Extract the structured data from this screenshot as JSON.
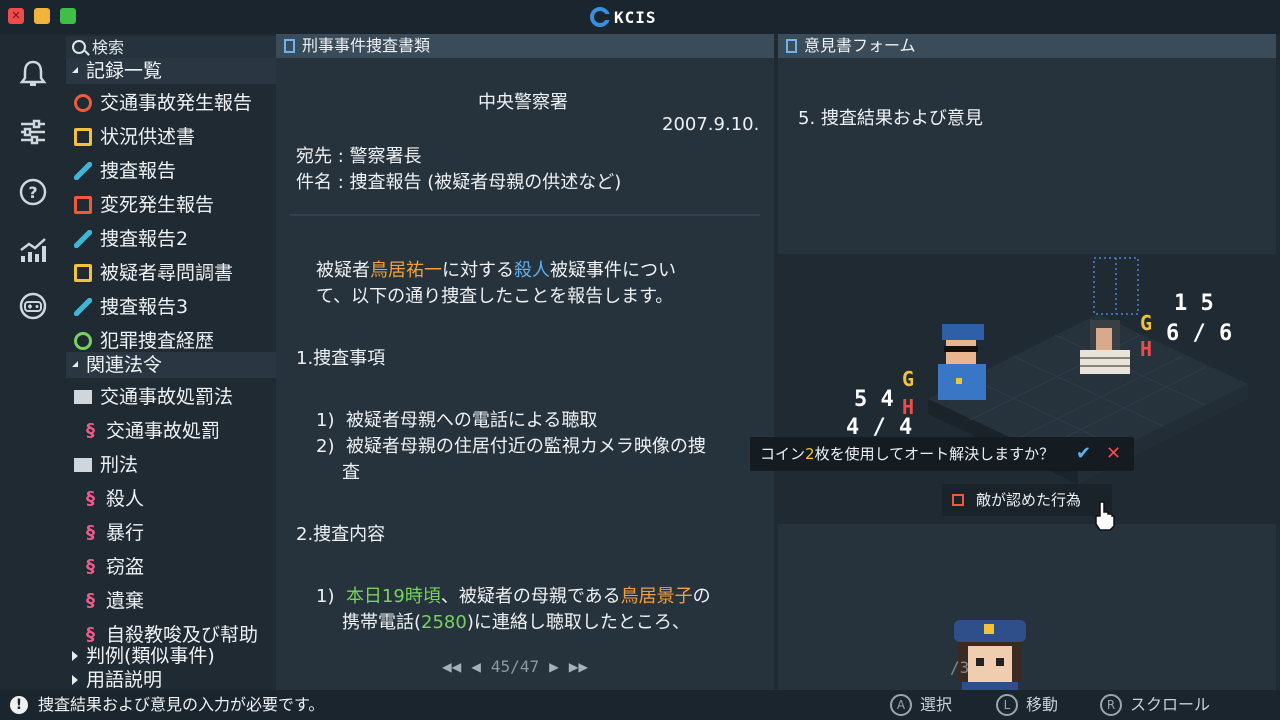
{
  "window": {
    "app_name": "KCIS",
    "close_icon": "close-icon",
    "accent": "#3a8ee0"
  },
  "sidebar_icons": [
    "bell-icon",
    "sliders-icon",
    "help-icon",
    "chart-icon",
    "gamepad-icon"
  ],
  "tree": {
    "search_label": "検索",
    "records_heading": "記録一覧",
    "records": [
      {
        "label": "交通事故発生報告",
        "icon": "no-entry-icon",
        "color": "#ee5a3a"
      },
      {
        "label": "状況供述書",
        "icon": "document-icon",
        "color": "#f2c23a"
      },
      {
        "label": "捜査報告",
        "icon": "pen-icon",
        "color": "#3fb6d8"
      },
      {
        "label": "変死発生報告",
        "icon": "body-icon",
        "color": "#ee5a3a"
      },
      {
        "label": "捜査報告2",
        "icon": "pen-icon",
        "color": "#3fb6d8"
      },
      {
        "label": "被疑者尋問調書",
        "icon": "document-icon",
        "color": "#f2c23a"
      },
      {
        "label": "捜査報告3",
        "icon": "pen-icon",
        "color": "#3fb6d8"
      },
      {
        "label": "犯罪捜査経歴",
        "icon": "history-icon",
        "color": "#77d35e"
      }
    ],
    "laws_heading": "関連法令",
    "laws": [
      {
        "label": "交通事故処罰法",
        "type": "folder"
      },
      {
        "label": "交通事故処罰",
        "type": "section"
      },
      {
        "label": "刑法",
        "type": "folder"
      },
      {
        "label": "殺人",
        "type": "section"
      },
      {
        "label": "暴行",
        "type": "section"
      },
      {
        "label": "窃盗",
        "type": "section"
      },
      {
        "label": "遺棄",
        "type": "section"
      },
      {
        "label": "自殺教唆及び幇助",
        "type": "section"
      }
    ],
    "precedents_heading": "判例(類似事件)",
    "glossary_heading": "用語説明"
  },
  "document": {
    "tab_title": "刑事事件捜査書類",
    "office": "中央警察署",
    "date": "2007.9.10.",
    "to": "宛先 : 警察署長",
    "subject": "件名 : 捜査報告 (被疑者母親の供述など)",
    "intro_1a": "被疑者",
    "intro_name": "鳥居祐一",
    "intro_1b": "に対する",
    "intro_crime": "殺人",
    "intro_1c": "被疑事件につい",
    "intro_2": "て、以下の通り捜査したことを報告します。",
    "sec1_title": "1.捜査事項",
    "sec1_items": [
      {
        "num": "1)",
        "text": "被疑者母親への電話による聴取"
      },
      {
        "num": "2)",
        "text": "被疑者母親の住居付近の監視カメラ映像の捜"
      }
    ],
    "sec1_item2_cont": "査",
    "sec2_title": "2.捜査内容",
    "sec2_num": "1)",
    "sec2_time": "本日19時頃",
    "sec2_a": "、被疑者の母親である",
    "sec2_mother": "鳥居景子",
    "sec2_b": "の",
    "sec2_c": "携帯電話(",
    "sec2_phone": "2580",
    "sec2_d": ")に連絡し聴取したところ、",
    "pager": {
      "current": "45",
      "total": "47"
    }
  },
  "form": {
    "tab_title": "意見書フォーム",
    "heading": "5. 捜査結果および意見",
    "page_indicator": "/3"
  },
  "scene": {
    "left_stats": {
      "top": "5 4",
      "bottom": "4 / 4",
      "g": "G",
      "h": "H"
    },
    "right_stats": {
      "top": "1 5",
      "bottom": "6 / 6",
      "g": "G",
      "h": "H"
    }
  },
  "prompt": {
    "text_a": "コイン",
    "coins": "2",
    "text_b": "枚を使用してオート解決しますか？",
    "confirm": "✔",
    "cancel": "✕"
  },
  "choice": {
    "label": "敵が認めた行為"
  },
  "status": {
    "message": "捜査結果および意見の入力が必要です。",
    "warn_glyph": "!",
    "hints": [
      {
        "button": "A",
        "label": "選択"
      },
      {
        "button": "L",
        "label": "移動"
      },
      {
        "button": "R",
        "label": "スクロール"
      }
    ]
  }
}
